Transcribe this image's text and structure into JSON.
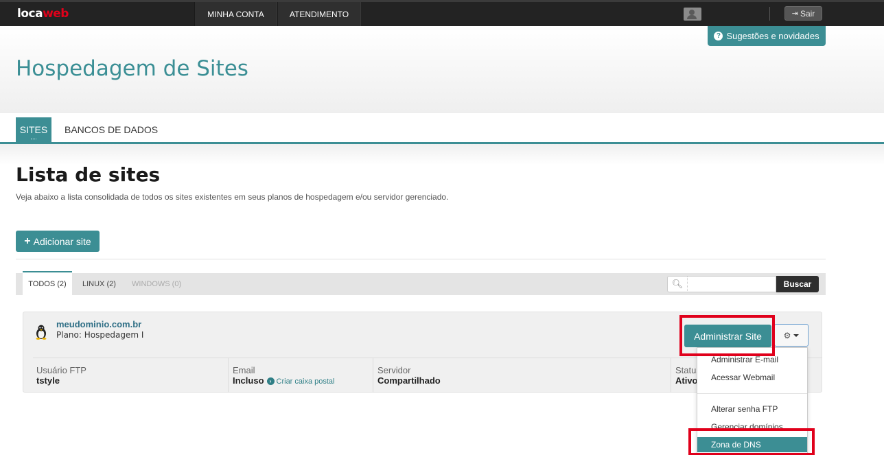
{
  "topbar": {
    "logo_part1": "loca",
    "logo_part2": "web",
    "nav": [
      "MINHA CONTA",
      "ATENDIMENTO"
    ],
    "logout_label": "Sair",
    "logo_color": "#e2001a"
  },
  "header": {
    "suggest_label": "Sugestões e novidades",
    "title": "Hospedagem de Sites"
  },
  "tabs": {
    "sites": "SITES",
    "databases": "BANCOS DE DADOS"
  },
  "section": {
    "title": "Lista de sites",
    "description": "Veja abaixo a lista consolidada de todos os sites existentes em seus planos de hospedagem e/ou servidor gerenciado.",
    "add_label": "Adicionar site"
  },
  "filters": {
    "all": "TODOS (2)",
    "linux": "LINUX (2)",
    "windows": "WINDOWS (0)",
    "search_placeholder": "",
    "search_button": "Buscar"
  },
  "site": {
    "domain": "meudominio.com.br",
    "plan": "Plano: Hospedagem I",
    "admin_button": "Administrar Site",
    "ftp_label": "Usuário FTP",
    "ftp_value": "tstyle",
    "email_label": "Email",
    "email_value": "Incluso",
    "email_link": "Criar caixa postal",
    "server_label": "Servidor",
    "server_value": "Compartilhado",
    "status_label": "Status",
    "status_value": "Ativo"
  },
  "dropdown": {
    "items": [
      "Administrar E-mail",
      "Acessar Webmail",
      "Alterar senha FTP",
      "Gerenciar domínios",
      "Zona de DNS"
    ]
  },
  "colors": {
    "accent": "#3c8e94",
    "highlight": "#e0001b"
  }
}
